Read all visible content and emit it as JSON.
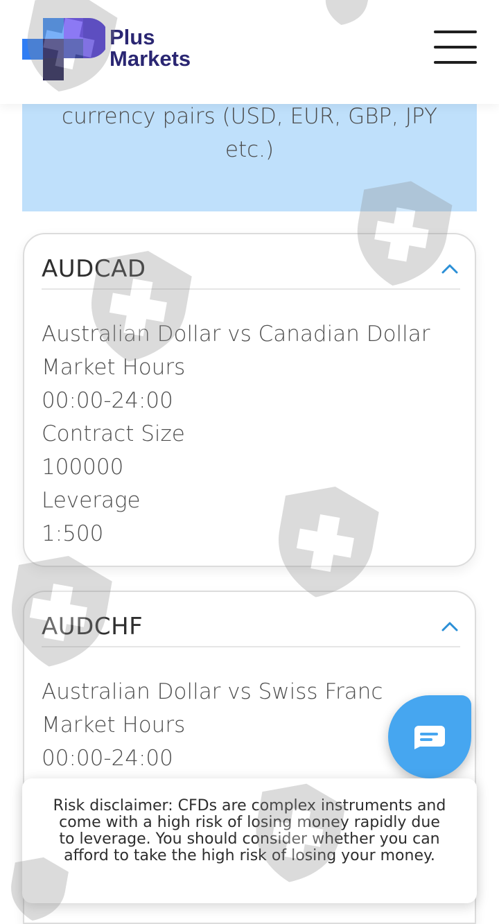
{
  "header": {
    "brand_line1": "Plus",
    "brand_line2": "Markets",
    "menu_icon": "hamburger-menu-icon"
  },
  "info_band": {
    "text": "currency pairs (USD, EUR, GBP, JPY etc.)"
  },
  "cards": [
    {
      "title": "AUDCAD",
      "chevron_icon": "chevron-up-icon",
      "lines": [
        "Australian Dollar vs Canadian Dollar",
        "Market Hours",
        "00:00-24:00",
        "Contract Size",
        "100000",
        "Leverage",
        "1:500"
      ]
    },
    {
      "title": "AUDCHF",
      "chevron_icon": "chevron-up-icon",
      "lines": [
        "Australian Dollar vs Swiss Franc",
        "Market Hours",
        "00:00-24:00"
      ]
    }
  ],
  "chat": {
    "icon": "chat-bubble-icon"
  },
  "disclaimer": {
    "text": "Risk disclaimer: CFDs are complex instruments and come with a high risk of losing money rapidly due to leverage. You should consider whether you can afford to take the high risk of losing your money."
  },
  "colors": {
    "brand": "#2a2672",
    "accent_blue": "#46a6f0",
    "info_band_bg": "#bfe0fb",
    "chevron": "#2b8fd6"
  },
  "watermark": {
    "icon": "shield-plus-watermark-icon"
  }
}
